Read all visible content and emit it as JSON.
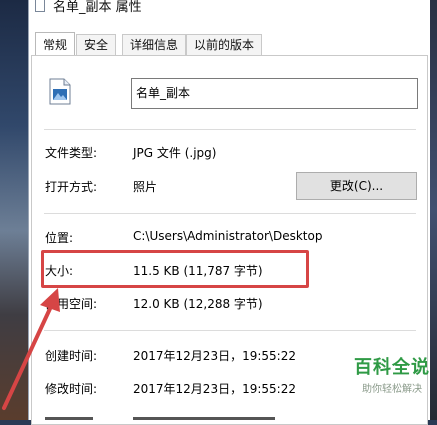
{
  "window": {
    "title": "名单_副本 属性"
  },
  "tabs": [
    {
      "label": "常规"
    },
    {
      "label": "安全"
    },
    {
      "label": "详细信息"
    },
    {
      "label": "以前的版本"
    }
  ],
  "general": {
    "file_name": "名单_副本",
    "file_type_label": "文件类型:",
    "file_type_value": "JPG 文件 (.jpg)",
    "open_with_label": "打开方式:",
    "open_with_value": "照片",
    "change_button": "更改(C)...",
    "location_label": "位置:",
    "location_value": "C:\\Users\\Administrator\\Desktop",
    "size_label": "大小:",
    "size_value": "11.5 KB (11,787 字节)",
    "size_on_disk_label": "占用空间:",
    "size_on_disk_value": "12.0 KB (12,288 字节)",
    "created_label": "创建时间:",
    "created_value": "2017年12月23日，19:55:22",
    "modified_label": "修改时间:",
    "modified_value": "2017年12月23日，19:55:22"
  },
  "watermark": {
    "title": "百科全说",
    "subtitle": "助你轻松解决"
  },
  "colors": {
    "highlight": "#d64545",
    "watermark": "#2f9a45"
  }
}
